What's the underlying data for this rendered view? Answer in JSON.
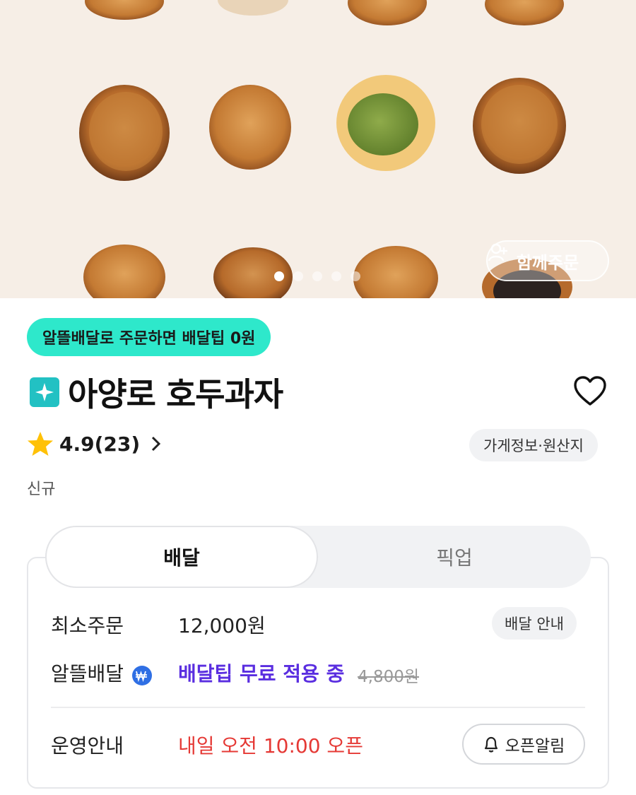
{
  "hero": {
    "carousel_total": 5,
    "carousel_active": 1,
    "group_order_label": "함께주문"
  },
  "promo": {
    "label": "알뜰배달로 주문하면 배달팁 0원"
  },
  "store": {
    "name": "아양로 호두과자",
    "badge_icon": "sparkle-icon"
  },
  "rating": {
    "text": "4.9(23)",
    "score": 4.9,
    "reviews": 23
  },
  "info_chip": {
    "label": "가게정보·원산지"
  },
  "new_label": "신규",
  "tabs": [
    {
      "label": "배달",
      "active": true
    },
    {
      "label": "픽업",
      "active": false
    }
  ],
  "details": {
    "min_order_label": "최소주문",
    "min_order_value": "12,000원",
    "delivery_info_label": "배달 안내",
    "saving_label": "알뜰배달",
    "free_tip_text": "배달팁 무료 적용 중",
    "old_tip": "4,800원",
    "ops_label": "운영안내",
    "open_time": "내일 오전 10:00 오픈",
    "open_alarm_label": "오픈알림"
  },
  "colors": {
    "promo_bg": "#2ee8cb",
    "free_tip": "#5a2ee0",
    "open_time": "#e53935",
    "star": "#ffc107",
    "badge": "#22c1c3"
  }
}
